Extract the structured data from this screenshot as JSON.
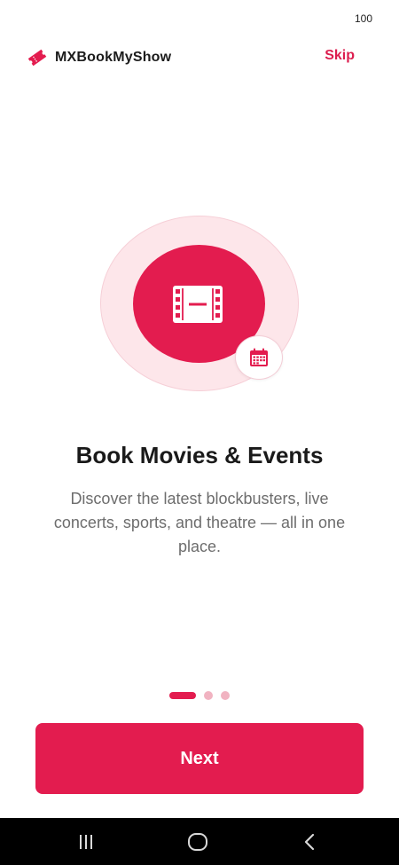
{
  "status_bar": {
    "battery": "100"
  },
  "header": {
    "brand_name": "MXBookMyShow",
    "skip_label": "Skip"
  },
  "onboarding": {
    "title": "Book Movies & Events",
    "description": "Discover the latest blockbusters, live concerts, sports, and theatre — all in one place.",
    "current_page": 1,
    "total_pages": 3
  },
  "actions": {
    "next_label": "Next"
  },
  "icons": {
    "brand": "ticket-icon",
    "hero": "film-icon",
    "badge": "calendar-icon",
    "nav": [
      "recent-apps-icon",
      "home-icon",
      "back-icon"
    ]
  },
  "colors": {
    "accent": "#e31c4f",
    "accent_light": "#fde6ea",
    "title_text": "#1a1a1a",
    "body_text": "#6d6d6d"
  }
}
